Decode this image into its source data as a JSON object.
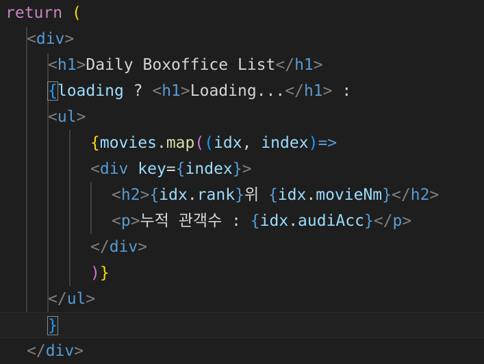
{
  "editor": {
    "theme_colors": {
      "background": "#1e1e1e",
      "keyword": "#c586c0",
      "tag": "#569cd6",
      "tag_bracket": "#808080",
      "variable": "#9cdcfe",
      "function": "#dcdcaa",
      "bracket_level_1": "#ffd700",
      "bracket_level_2": "#da70d6",
      "bracket_level_3": "#179fff",
      "text": "#d4d4d4"
    },
    "lines": [
      {
        "tokens": [
          "return",
          " ",
          "("
        ]
      },
      {
        "tokens": [
          "<",
          "div",
          ">"
        ]
      },
      {
        "tokens": [
          "<",
          "h1",
          ">",
          "Daily Boxoffice List",
          "</",
          "h1",
          ">"
        ]
      },
      {
        "tokens": [
          "{",
          "loading",
          " ? ",
          "<",
          "h1",
          ">",
          "Loading...",
          "</",
          "h1",
          ">",
          " :"
        ]
      },
      {
        "tokens": [
          "<",
          "ul",
          ">"
        ]
      },
      {
        "tokens": [
          "{",
          "movies",
          ".",
          "map",
          "(",
          "(",
          "idx",
          ", ",
          "index",
          ")",
          "=>"
        ]
      },
      {
        "tokens": [
          "<",
          "div",
          " ",
          "key",
          "=",
          "{",
          "index",
          "}",
          ">"
        ]
      },
      {
        "tokens": [
          "<",
          "h2",
          ">",
          "{",
          "idx",
          ".",
          "rank",
          "}",
          "위 ",
          "{",
          "idx",
          ".",
          "movieNm",
          "}",
          "</",
          "h2",
          ">"
        ]
      },
      {
        "tokens": [
          "<",
          "p",
          ">",
          "누적 관객수 : ",
          "{",
          "idx",
          ".",
          "audiAcc",
          "}",
          "</",
          "p",
          ">"
        ]
      },
      {
        "tokens": [
          "</",
          "div",
          ">"
        ]
      },
      {
        "tokens": [
          ")",
          "}"
        ]
      },
      {
        "tokens": [
          "</",
          "ul",
          ">"
        ]
      },
      {
        "tokens": [
          "}"
        ]
      },
      {
        "tokens": [
          "</",
          "div",
          ">"
        ]
      }
    ]
  }
}
